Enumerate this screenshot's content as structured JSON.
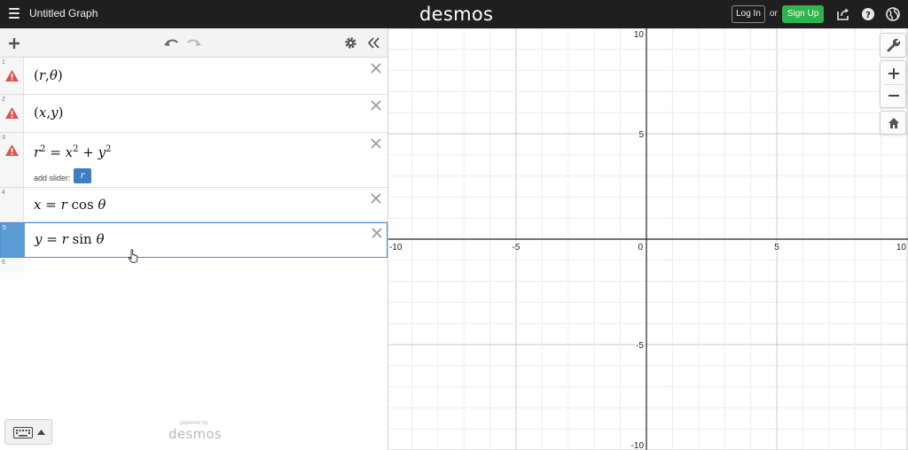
{
  "topbar": {
    "title": "Untitled Graph",
    "brand": "desmos",
    "login_label": "Log In",
    "or_label": "or",
    "signup_label": "Sign Up",
    "colors": {
      "bar": "#1f1f1f",
      "signup": "#2fb34a"
    }
  },
  "expressions": [
    {
      "num": "1",
      "warning": true,
      "tex": "(r,θ)"
    },
    {
      "num": "2",
      "warning": true,
      "tex": "(x,y)"
    },
    {
      "num": "3",
      "warning": true,
      "tex": "r^2 = x^2 + y^2",
      "slider_label": "add slider:",
      "slider_var": "r"
    },
    {
      "num": "4",
      "warning": false,
      "tex": "x = r cos θ"
    },
    {
      "num": "5",
      "warning": false,
      "tex": "y = r sin θ",
      "active": true
    },
    {
      "num": "6",
      "warning": false,
      "tex": ""
    }
  ],
  "powered_by": {
    "line1": "powered by",
    "line2": "desmos"
  },
  "graph": {
    "x_range": [
      -10,
      10
    ],
    "y_range": [
      -10,
      10
    ],
    "major_step": 5,
    "minor_step": 1,
    "grid": true,
    "x_tick_labels": [
      "-10",
      "-5",
      "0",
      "5",
      "10"
    ],
    "y_tick_labels": [
      "10",
      "5",
      "-5",
      "-10"
    ],
    "x_tick_values": [
      -10,
      -5,
      0,
      5,
      10
    ],
    "y_tick_values": [
      10,
      5,
      -5,
      -10
    ]
  },
  "colors": {
    "warning": "#d9534f",
    "active": "#5b9bd5",
    "slider_chip": "#3d7fc1"
  }
}
